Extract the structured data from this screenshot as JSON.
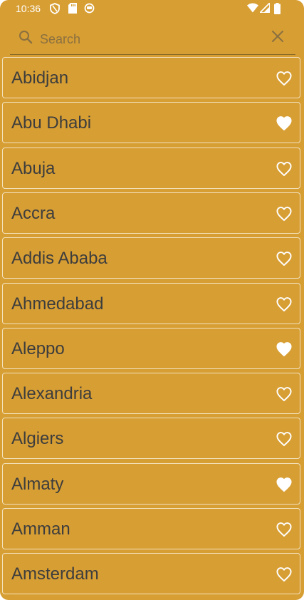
{
  "status_bar": {
    "time": "10:36",
    "left_icons": [
      "shield-icon",
      "sd-card-icon",
      "sync-icon"
    ],
    "right_icons": [
      "wifi-icon",
      "signal-icon",
      "battery-icon"
    ]
  },
  "search": {
    "placeholder": "Search",
    "value": "",
    "search_icon": "search-icon",
    "clear_icon": "close-icon"
  },
  "colors": {
    "background": "#d79e34",
    "item_border": "#f3e2bd",
    "text": "#3d3d3d",
    "icon": "#ffffff"
  },
  "cities": [
    {
      "name": "Abidjan",
      "favorite": false
    },
    {
      "name": "Abu Dhabi",
      "favorite": true
    },
    {
      "name": "Abuja",
      "favorite": false
    },
    {
      "name": "Accra",
      "favorite": false
    },
    {
      "name": "Addis Ababa",
      "favorite": false
    },
    {
      "name": "Ahmedabad",
      "favorite": false
    },
    {
      "name": "Aleppo",
      "favorite": true
    },
    {
      "name": "Alexandria",
      "favorite": false
    },
    {
      "name": "Algiers",
      "favorite": false
    },
    {
      "name": "Almaty",
      "favorite": true
    },
    {
      "name": "Amman",
      "favorite": false
    },
    {
      "name": "Amsterdam",
      "favorite": false
    }
  ]
}
